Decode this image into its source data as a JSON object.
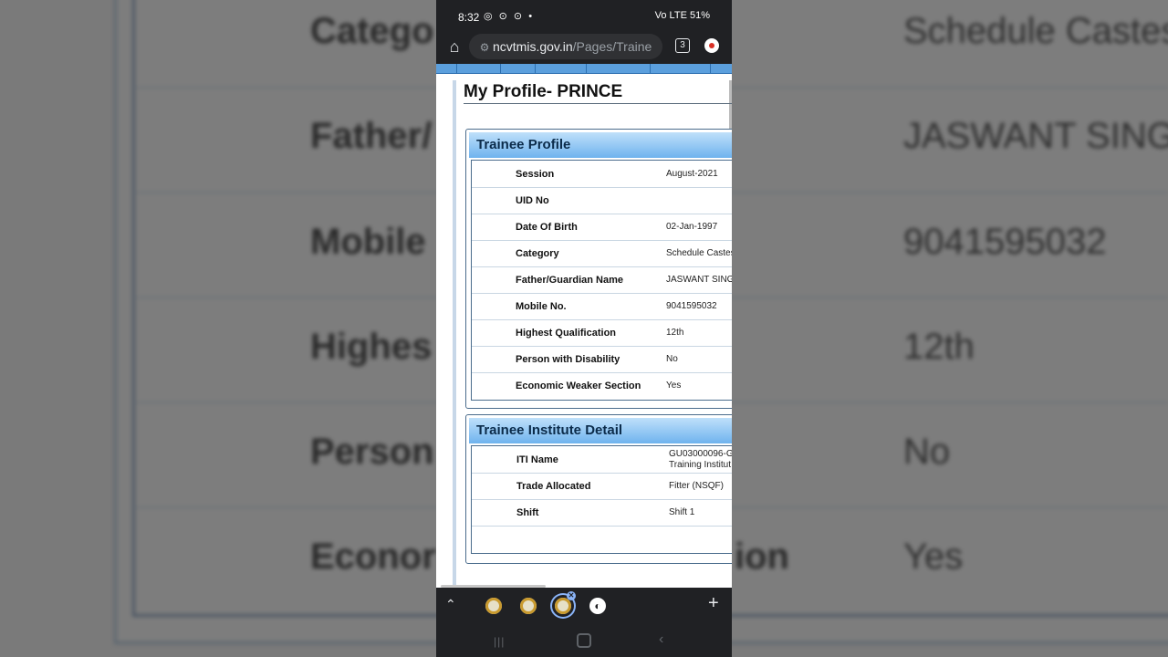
{
  "background": {
    "rows": [
      {
        "label": "Catego",
        "value": "Schedule Castes"
      },
      {
        "label": "Father/",
        "value": "JASWANT SING"
      },
      {
        "label": "Mobile",
        "value": "9041595032"
      },
      {
        "label": "Highes",
        "value": "12th"
      },
      {
        "label": "Person",
        "value": "No"
      },
      {
        "label": "Econor",
        "mid": "ion",
        "value": "Yes"
      }
    ]
  },
  "status_bar": {
    "time": "8:32",
    "left_icons": "◎ ⊙ ⊙ •",
    "right_text": "Vo LTE 51%"
  },
  "browser": {
    "url_host": "ncvtmis.gov.in",
    "url_path": "/Pages/Traine",
    "tab_count": "3"
  },
  "page": {
    "title": "My Profile- PRINCE",
    "trainee_profile": {
      "heading": "Trainee Profile",
      "rows": [
        {
          "label": "Session",
          "value": "August-2021"
        },
        {
          "label": "UID No",
          "value": ""
        },
        {
          "label": "Date Of Birth",
          "value": "02-Jan-1997"
        },
        {
          "label": "Category",
          "value": "Schedule Castes"
        },
        {
          "label": "Father/Guardian Name",
          "value": "JASWANT SINGH"
        },
        {
          "label": "Mobile No.",
          "value": "9041595032"
        },
        {
          "label": "Highest Qualification",
          "value": "12th"
        },
        {
          "label": "Person with Disability",
          "value": "No"
        },
        {
          "label": "Economic Weaker Section",
          "value": "Yes"
        }
      ]
    },
    "institute_detail": {
      "heading": "Trainee Institute Detail",
      "rows": [
        {
          "label": "ITI Name",
          "value_line1": "GU03000096-G",
          "value_line2": "Training Institut"
        },
        {
          "label": "Trade Allocated",
          "value": "Fitter (NSQF)"
        },
        {
          "label": "Shift",
          "value": "Shift 1"
        }
      ]
    }
  },
  "bottom_bar": {
    "plus": "+"
  }
}
